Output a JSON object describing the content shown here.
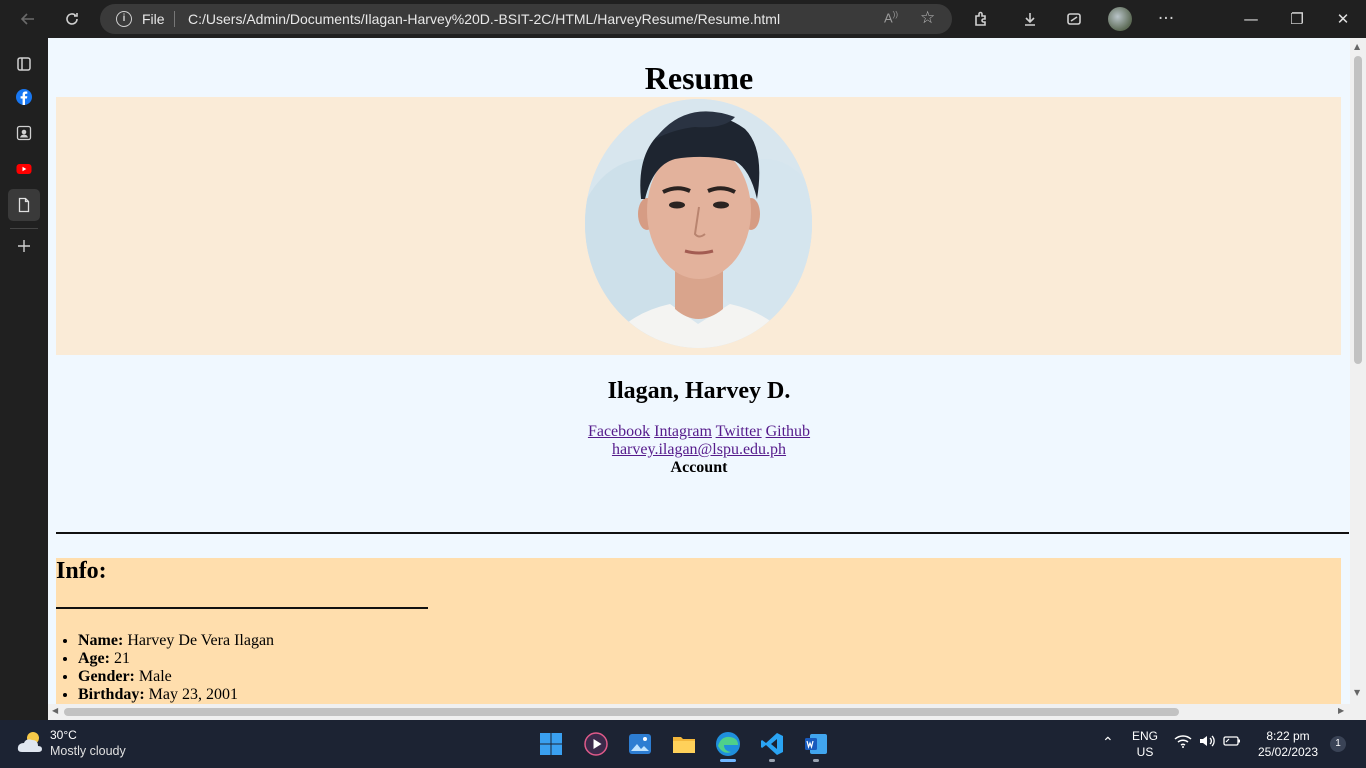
{
  "browser": {
    "address_scheme": "File",
    "url": "C:/Users/Admin/Documents/Ilagan-Harvey%20D.-BSIT-2C/HTML/HarveyResume/Resume.html"
  },
  "page": {
    "title": "Resume",
    "name": "Ilagan, Harvey D.",
    "links": [
      "Facebook",
      "Intagram",
      "Twitter",
      "Github"
    ],
    "email": "harvey.ilagan@lspu.edu.ph",
    "account_label": "Account",
    "info": {
      "heading": "Info:",
      "items": [
        {
          "label": "Name:",
          "value": "Harvey De Vera Ilagan"
        },
        {
          "label": "Age:",
          "value": "21"
        },
        {
          "label": "Gender:",
          "value": "Male"
        },
        {
          "label": "Birthday:",
          "value": "May 23, 2001"
        }
      ]
    },
    "colors": {
      "background": "#f0f8ff",
      "photo_band": "#faebd7",
      "info_band": "#ffdead",
      "link": "#551a8b"
    }
  },
  "taskbar": {
    "weather_temp": "30°C",
    "weather_desc": "Mostly cloudy",
    "lang_top": "ENG",
    "lang_bottom": "US",
    "time": "8:22 pm",
    "date": "25/02/2023",
    "notification_count": "1"
  }
}
